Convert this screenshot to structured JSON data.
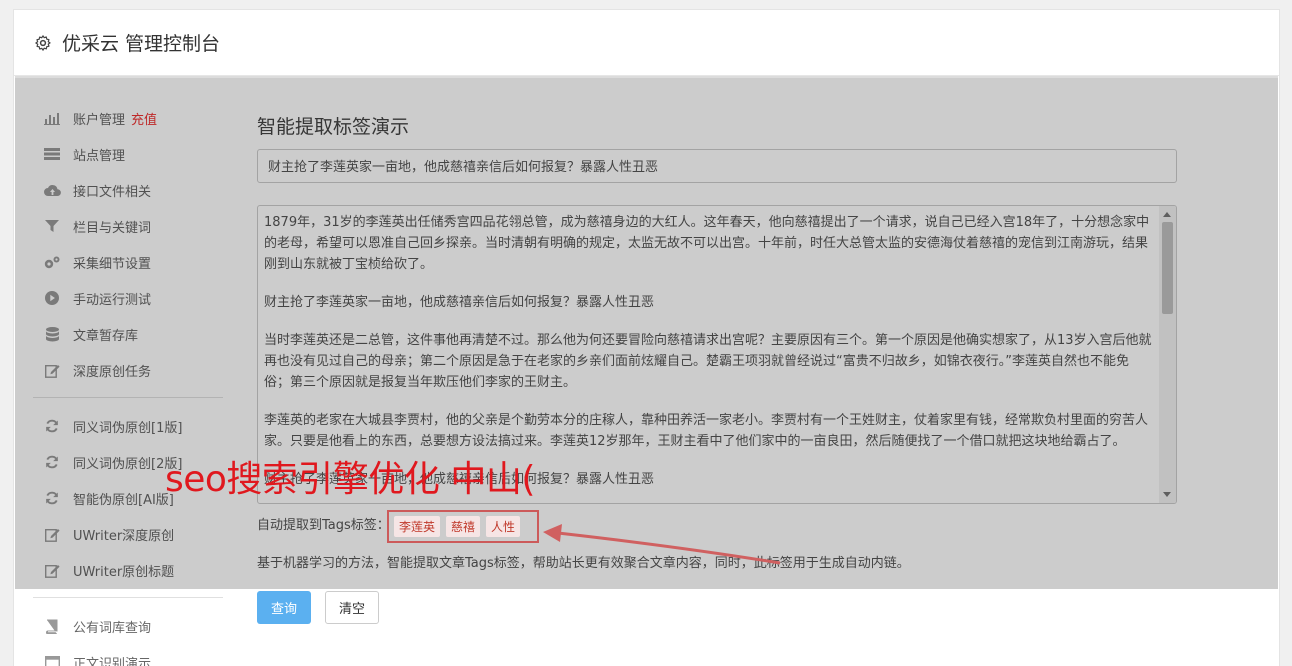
{
  "header": {
    "title": "优采云 管理控制台",
    "icon": "gear-icon"
  },
  "sidebar": {
    "group1": [
      {
        "label": "账户管理",
        "badge": "充值",
        "icon": "bar-chart-icon"
      },
      {
        "label": "站点管理",
        "icon": "server-icon"
      },
      {
        "label": "接口文件相关",
        "icon": "cloud-upload-icon"
      },
      {
        "label": "栏目与关键词",
        "icon": "filter-icon"
      },
      {
        "label": "采集细节设置",
        "icon": "gears-icon"
      },
      {
        "label": "手动运行测试",
        "icon": "play-icon"
      },
      {
        "label": "文章暂存库",
        "icon": "database-icon"
      },
      {
        "label": "深度原创任务",
        "icon": "edit-icon"
      }
    ],
    "group2": [
      {
        "label": "同义词伪原创[1版]",
        "icon": "refresh-icon"
      },
      {
        "label": "同义词伪原创[2版]",
        "icon": "refresh-icon"
      },
      {
        "label": "智能伪原创[AI版]",
        "icon": "refresh-icon"
      },
      {
        "label": "UWriter深度原创",
        "icon": "edit-icon"
      },
      {
        "label": "UWriter原创标题",
        "icon": "edit-icon"
      }
    ],
    "group3": [
      {
        "label": "公有词库查询",
        "icon": "book-icon"
      },
      {
        "label": "正文识别演示",
        "icon": "window-icon"
      }
    ]
  },
  "main": {
    "title": "智能提取标签演示",
    "title_input_value": "财主抢了李莲英家一亩地，他成慈禧亲信后如何报复？暴露人性丑恶",
    "content_paragraphs": [
      "1879年，31岁的李莲英出任储秀宫四品花翎总管，成为慈禧身边的大红人。这年春天，他向慈禧提出了一个请求，说自己已经入宫18年了，十分想念家中的老母，希望可以恩准自己回乡探亲。当时清朝有明确的规定，太监无故不可以出宫。十年前，时任大总管太监的安德海仗着慈禧的宠信到江南游玩，结果刚到山东就被丁宝桢给砍了。",
      "财主抢了李莲英家一亩地，他成慈禧亲信后如何报复？暴露人性丑恶",
      "当时李莲英还是二总管，这件事他再清楚不过。那么他为何还要冒险向慈禧请求出宫呢？主要原因有三个。第一个原因是他确实想家了，从13岁入宫后他就再也没有见过自己的母亲；第二个原因是急于在老家的乡亲们面前炫耀自己。楚霸王项羽就曾经说过“富贵不归故乡，如锦衣夜行。”李莲英自然也不能免俗；第三个原因就是报复当年欺压他们李家的王财主。",
      "李莲英的老家在大城县李贾村，他的父亲是个勤劳本分的庄稼人，靠种田养活一家老小。李贾村有一个王姓财主，仗着家里有钱，经常欺负村里面的穷苦人家。只要是他看上的东西，总要想方设法搞过来。李莲英12岁那年，王财主看中了他们家中的一亩良田，然后随便找了一个借口就把这块地给霸占了。",
      "财主抢了李莲英家一亩地，他成慈禧亲信后如何报复？暴露人性丑恶"
    ],
    "tags_label": "自动提取到Tags标签：",
    "tags": [
      "李莲英",
      "慈禧",
      "人性"
    ],
    "description": "基于机器学习的方法，智能提取文章Tags标签，帮助站长更有效聚合文章内容，同时，此标签用于生成自动内链。",
    "query_button": "查询",
    "clear_button": "清空"
  },
  "overlay": {
    "text": "seo搜索引擎优化 中山(",
    "color": "#e0181e"
  },
  "colors": {
    "accent": "#5bb0f0",
    "recharge": "#e33333",
    "annotation": "#cc5a5a"
  }
}
